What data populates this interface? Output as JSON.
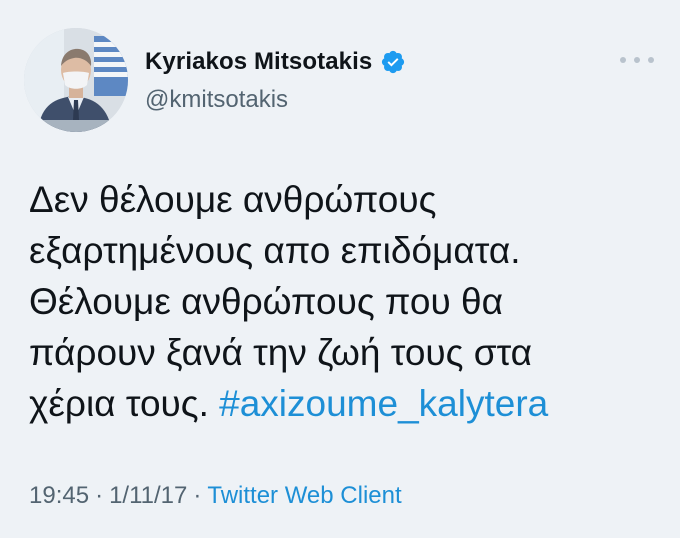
{
  "author": {
    "display_name": "Kyriakos Mitsotakis",
    "handle": "@kmitsotakis",
    "verified_icon": "verified-badge-icon",
    "avatar": "profile-photo"
  },
  "menu_icon": "more-options-icon",
  "tweet": {
    "lines": [
      "Δεν θέλουμε ανθρώπους",
      "εξαρτημένους απο επιδόματα.",
      "Θέλουμε ανθρώπους που θα",
      "πάρουν ξανά την ζωή τους στα",
      "χέρια τους."
    ],
    "hashtag": "#axizoume_kalytera"
  },
  "meta": {
    "time": "19:45",
    "separator": "·",
    "date": "1/11/17",
    "source": "Twitter Web Client"
  },
  "colors": {
    "background": "#eef2f6",
    "link": "#1d8fd6",
    "secondary_text": "#536471",
    "verified": "#1d9bf0"
  }
}
